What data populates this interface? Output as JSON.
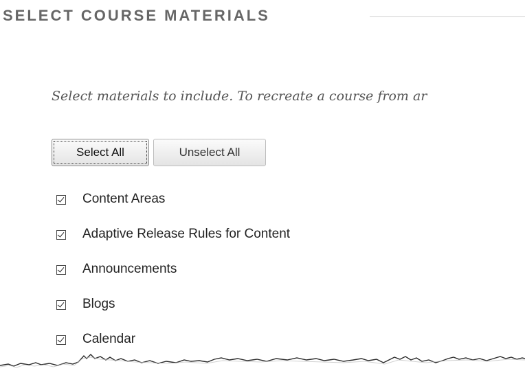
{
  "section": {
    "title": "SELECT COURSE MATERIALS"
  },
  "instructions": "Select materials to include. To recreate a course from ar",
  "buttons": {
    "select_all": "Select All",
    "unselect_all": "Unselect All"
  },
  "materials": [
    {
      "label": "Content Areas",
      "checked": true
    },
    {
      "label": "Adaptive Release Rules for Content",
      "checked": true
    },
    {
      "label": "Announcements",
      "checked": true
    },
    {
      "label": "Blogs",
      "checked": true
    },
    {
      "label": "Calendar",
      "checked": true
    }
  ],
  "colors": {
    "header_text": "#666666",
    "instructions_text": "#555555",
    "button_bg": "#e9e9e9",
    "rule": "#cfcfcf"
  }
}
